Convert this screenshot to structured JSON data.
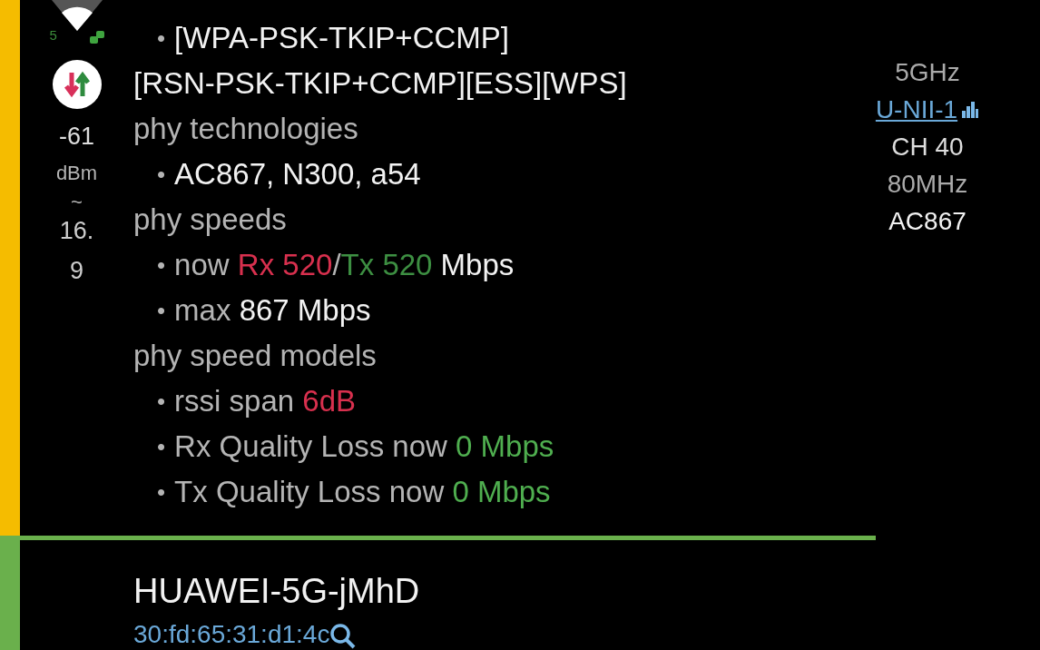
{
  "network": {
    "color": "#f5bc00",
    "band_digit": "5",
    "signal": "-61",
    "signal_unit": "dBm",
    "approx": "~",
    "distance": "16.9",
    "details": [
      {
        "kind": "bullet",
        "marker": "•",
        "parts": [
          {
            "kind": "value",
            "text": "[WPA-PSK-TKIP+CCMP]"
          }
        ]
      },
      {
        "kind": "plain",
        "parts": [
          {
            "kind": "value",
            "text": "[RSN-PSK-TKIP+CCMP][ESS][WPS]"
          }
        ]
      },
      {
        "kind": "heading",
        "parts": [
          {
            "kind": "label",
            "text": "phy technologies"
          }
        ]
      },
      {
        "kind": "bullet",
        "marker": "•",
        "parts": [
          {
            "kind": "value",
            "text": "AC867, N300, a54"
          }
        ]
      },
      {
        "kind": "heading",
        "parts": [
          {
            "kind": "label",
            "text": "phy speeds"
          }
        ]
      },
      {
        "kind": "bullet",
        "marker": "•",
        "parts": [
          {
            "kind": "label",
            "text": "now "
          },
          {
            "kind": "bad",
            "text": "Rx 520"
          },
          {
            "kind": "label",
            "text": "/"
          },
          {
            "kind": "good",
            "text": "Tx 520"
          },
          {
            "kind": "value",
            "text": " Mbps"
          }
        ]
      },
      {
        "kind": "bullet",
        "marker": "•",
        "parts": [
          {
            "kind": "label",
            "text": "max "
          },
          {
            "kind": "value",
            "text": "867 Mbps"
          }
        ]
      },
      {
        "kind": "heading",
        "parts": [
          {
            "kind": "label",
            "text": "phy speed models"
          }
        ]
      },
      {
        "kind": "bullet",
        "marker": "•",
        "parts": [
          {
            "kind": "label",
            "text": "rssi span "
          },
          {
            "kind": "bad",
            "text": "6dB"
          }
        ]
      },
      {
        "kind": "bullet",
        "marker": "•",
        "parts": [
          {
            "kind": "label",
            "text": "Rx Quality Loss now "
          },
          {
            "kind": "fine",
            "text": "0 Mbps"
          }
        ]
      },
      {
        "kind": "bullet",
        "marker": "•",
        "parts": [
          {
            "kind": "label",
            "text": "Tx Quality Loss now "
          },
          {
            "kind": "fine",
            "text": "0 Mbps"
          }
        ]
      }
    ],
    "band": "5GHz",
    "band_plan": "U-NII-1",
    "channel": "CH 40",
    "width": "80MHz",
    "standard": "AC867"
  },
  "next_network": {
    "color": "#6ab04c",
    "ssid": "HUAWEI-5G-jMhD",
    "bssid": "30:fd:65:31:d1:4c"
  }
}
